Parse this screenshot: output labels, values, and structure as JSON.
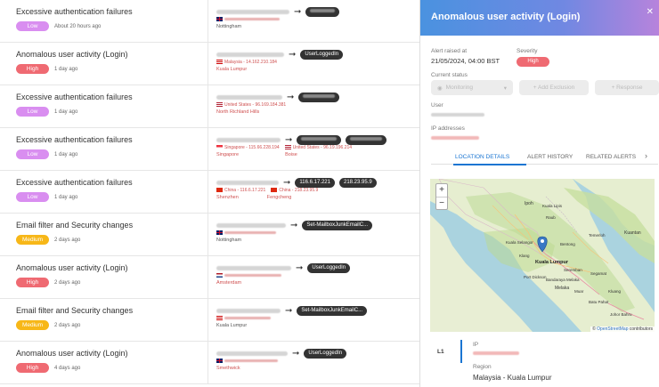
{
  "alerts": [
    {
      "title": "Excessive authentication failures",
      "severity": "Low",
      "time": "About 20 hours ago",
      "target": "",
      "location_line": "Nottingham",
      "location_style": "dark",
      "flag": "uk",
      "extra_pill": ""
    },
    {
      "title": "Anomalous user activity (Login)",
      "severity": "High",
      "time": "1 day ago",
      "target": "UserLoggedIn",
      "ip_text": "Malaysia - 14.162.210.184",
      "location_line": "Kuala Lumpur",
      "location_style": "red",
      "flag": "my",
      "extra_pill": ""
    },
    {
      "title": "Excessive authentication failures",
      "severity": "Low",
      "time": "1 day ago",
      "target": "",
      "ip_text": "United States - 96.169.184.381",
      "location_line": "North Richland Hills",
      "location_style": "red",
      "flag": "us",
      "extra_pill": ""
    },
    {
      "title": "Excessive authentication failures",
      "severity": "Low",
      "time": "1 day ago",
      "target": "",
      "ip_text": "Singapore - 115.66.228.194",
      "ip_text2": "United States - 96.19.196.214",
      "location_line": "Singapore",
      "location_line2": "Boise",
      "location_style": "red",
      "flag": "sg",
      "extra_pill": ""
    },
    {
      "title": "Excessive authentication failures",
      "severity": "Low",
      "time": "1 day ago",
      "target": "116.6.17.221",
      "target2": "218.23.95.9",
      "ip_text": "China - 116.6.17.221",
      "ip_text2": "China - 218.23.95.9",
      "location_line": "Shenzhen",
      "location_line2": "Fengcheng",
      "location_style": "red",
      "flag": "cn",
      "extra_pill": ""
    },
    {
      "title": "Email filter and Security changes",
      "severity": "Medium",
      "time": "2 days ago",
      "target": "Set-MailboxJunkEmailC...",
      "location_line": "Nottingham",
      "location_style": "dark",
      "flag": "uk",
      "extra_pill": ""
    },
    {
      "title": "Anomalous user activity (Login)",
      "severity": "High",
      "time": "2 days ago",
      "target": "UserLoggedIn",
      "location_line": "Amsterdam",
      "location_style": "red",
      "flag": "nl",
      "extra_pill": ""
    },
    {
      "title": "Email filter and Security changes",
      "severity": "Medium",
      "time": "2 days ago",
      "target": "Set-MailboxJunkEmailC...",
      "location_line": "Kuala Lumpur",
      "location_style": "dark",
      "flag": "my",
      "extra_pill": ""
    },
    {
      "title": "Anomalous user activity (Login)",
      "severity": "High",
      "time": "4 days ago",
      "target": "UserLoggedIn",
      "location_line": "Smethwick",
      "location_style": "red",
      "flag": "uk",
      "extra_pill": ""
    }
  ],
  "panel": {
    "title": "Anomalous user activity (Login)",
    "close_label": "✕",
    "alert_raised_label": "Alert raised at",
    "alert_raised_value": "21/05/2024, 04:00 BST",
    "severity_label": "Severity",
    "severity_value": "High",
    "status_label": "Current status",
    "status_value": "Monitoring",
    "add_exclusion_label": "+ Add Exclusion",
    "response_label": "+ Response",
    "user_label": "User",
    "ip_label": "IP addresses",
    "tabs": [
      "LOCATION DETAILS",
      "ALERT HISTORY",
      "RELATED ALERTS"
    ],
    "tab_next": "›",
    "map_attrib_prefix": "© ",
    "map_attrib_link": "OpenStreetMap",
    "map_attrib_suffix": " contributors",
    "zoom_in": "+",
    "zoom_out": "−",
    "map_labels": [
      "Ipoh",
      "Kuala Selangor",
      "Kuala Lumpur",
      "Seremban",
      "Melaka",
      "Bandaraya Melaka",
      "Port Dickson",
      "Johor Bahru",
      "Kuantan",
      "Temerloh",
      "Bentong",
      "Raub",
      "Kuala Lipis",
      "Batu Pahat",
      "Muar",
      "Segamat",
      "Kluang",
      "Klang"
    ],
    "location_tab_label": "L1",
    "loc_ip_label": "IP",
    "region_label": "Region",
    "region_value": "Malaysia - Kuala Lumpur"
  },
  "colors": {
    "low": "#d98ef0",
    "high": "#ef6a72",
    "medium": "#f7b718",
    "accent": "#1a75d2"
  }
}
